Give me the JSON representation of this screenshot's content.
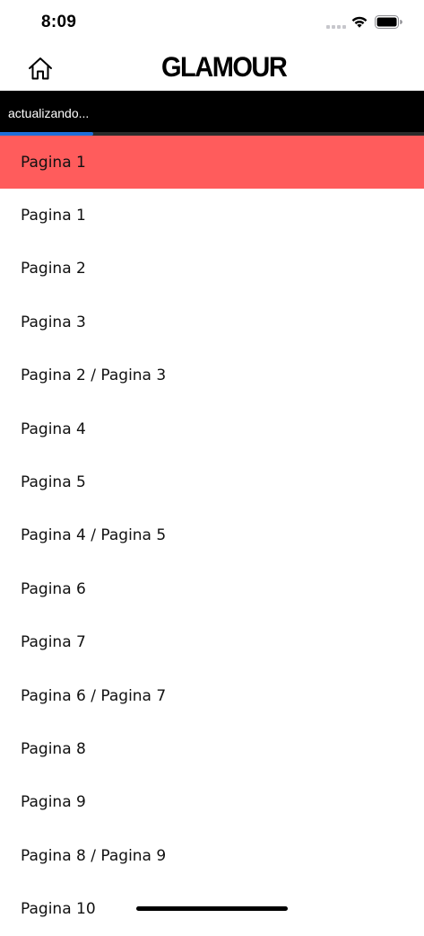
{
  "status_bar": {
    "time": "8:09",
    "icons": [
      "cellular-signal-icon",
      "wifi-icon",
      "battery-icon"
    ]
  },
  "nav": {
    "logo": "GLAMOUR",
    "home_icon": "home-icon"
  },
  "update": {
    "text": "actualizando...",
    "progress": 0.22,
    "progress_color": "#1e6fd9"
  },
  "colors": {
    "active_item_bg": "#ff5c5c",
    "update_bar_bg": "#000000"
  },
  "pages": [
    {
      "label": "Pagina 1",
      "active": true
    },
    {
      "label": "Pagina 1",
      "active": false
    },
    {
      "label": "Pagina 2",
      "active": false
    },
    {
      "label": "Pagina 3",
      "active": false
    },
    {
      "label": "Pagina 2 / Pagina 3",
      "active": false
    },
    {
      "label": "Pagina 4",
      "active": false
    },
    {
      "label": "Pagina 5",
      "active": false
    },
    {
      "label": "Pagina 4 / Pagina 5",
      "active": false
    },
    {
      "label": "Pagina 6",
      "active": false
    },
    {
      "label": "Pagina 7",
      "active": false
    },
    {
      "label": "Pagina 6 / Pagina 7",
      "active": false
    },
    {
      "label": "Pagina 8",
      "active": false
    },
    {
      "label": "Pagina 9",
      "active": false
    },
    {
      "label": "Pagina 8 / Pagina 9",
      "active": false
    },
    {
      "label": "Pagina 10",
      "active": false
    }
  ]
}
